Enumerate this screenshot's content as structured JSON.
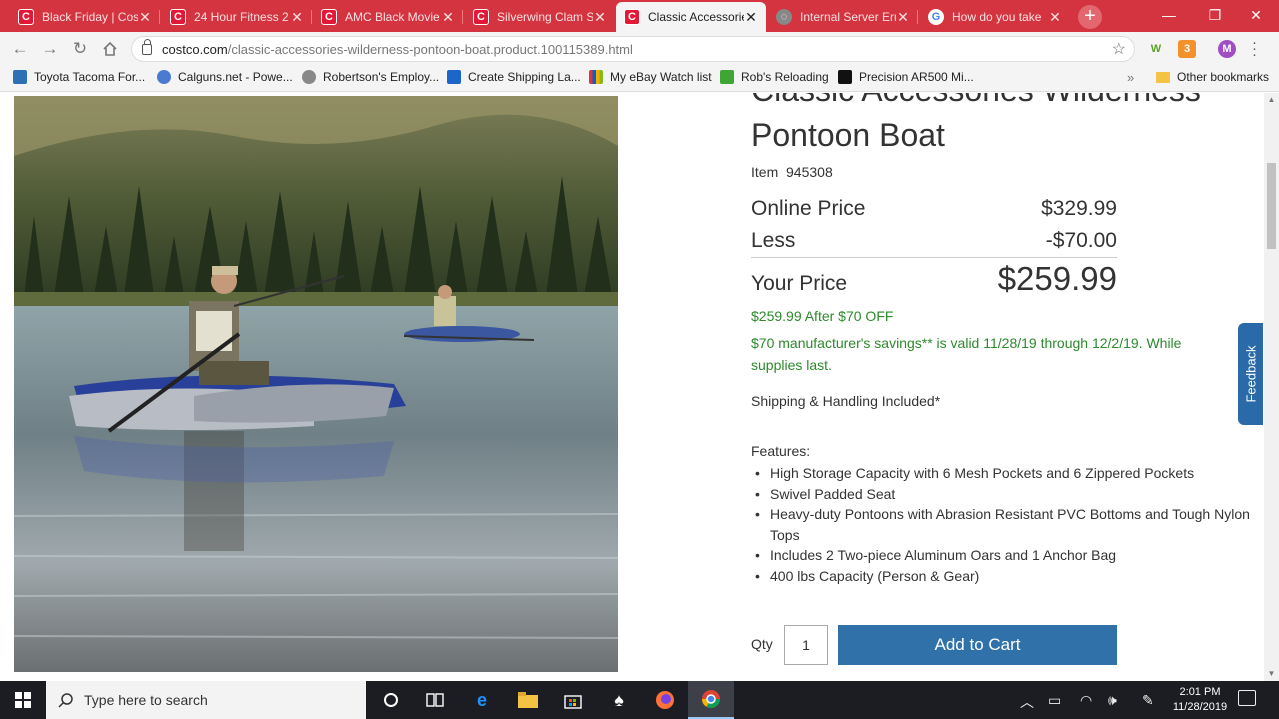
{
  "browser": {
    "tabs": [
      {
        "title": "Black Friday | Cost",
        "favicon": "costco"
      },
      {
        "title": "24 Hour Fitness 2",
        "favicon": "costco"
      },
      {
        "title": "AMC Black Movie",
        "favicon": "costco"
      },
      {
        "title": "Silverwing Clam S",
        "favicon": "costco"
      },
      {
        "title": "Classic Accessories",
        "favicon": "costco",
        "active": true
      },
      {
        "title": "Internal Server Err",
        "favicon": "globe-error"
      },
      {
        "title": "How do you take",
        "favicon": "google"
      }
    ],
    "url_host": "costco.com",
    "url_path": "/classic-accessories-wilderness-pontoon-boat.product.100115389.html",
    "profile_initial": "M",
    "extension_w": "W",
    "extension_badge": "3",
    "bookmarks": [
      {
        "label": "Toyota Tacoma For...",
        "color": "#2f6fb5"
      },
      {
        "label": "Calguns.net - Powe...",
        "color": "#4a7bd0"
      },
      {
        "label": "Robertson's Employ...",
        "color": "#888888"
      },
      {
        "label": "Create Shipping La...",
        "color": "#1b66c9"
      },
      {
        "label": "My eBay Watch list",
        "color": "#e53238"
      },
      {
        "label": "Rob's Reloading",
        "color": "#3fa535"
      },
      {
        "label": "Precision AR500 Mi...",
        "color": "#111111"
      }
    ],
    "other_bookmarks": "Other bookmarks",
    "more": "»"
  },
  "product": {
    "title": "Classic Accessories Wilderness Pontoon Boat",
    "item_label": "Item",
    "item_number": "945308",
    "online_price_label": "Online Price",
    "online_price": "$329.99",
    "less_label": "Less",
    "less_value": "-$70.00",
    "your_price_label": "Your Price",
    "your_price": "$259.99",
    "promo_line": "$259.99 After $70 OFF",
    "savings_line": "$70 manufacturer's savings** is valid 11/28/19 through 12/2/19. While supplies last.",
    "shipping": "Shipping & Handling Included*",
    "features_label": "Features:",
    "features": [
      "High Storage Capacity with 6 Mesh Pockets and 6 Zippered Pockets",
      "Swivel Padded Seat",
      "Heavy-duty Pontoons with Abrasion Resistant PVC Bottoms and Tough Nylon Tops",
      "Includes 2 Two-piece Aluminum Oars and 1 Anchor Bag",
      "400 lbs Capacity (Person & Gear)"
    ],
    "qty_label": "Qty",
    "qty_value": "1",
    "add_to_cart": "Add to Cart",
    "accent_color": "#3071a9",
    "promo_color": "#2b8a2b"
  },
  "feedback": "Feedback",
  "taskbar": {
    "search_placeholder": "Type here to search",
    "time": "2:01 PM",
    "date": "11/28/2019"
  }
}
